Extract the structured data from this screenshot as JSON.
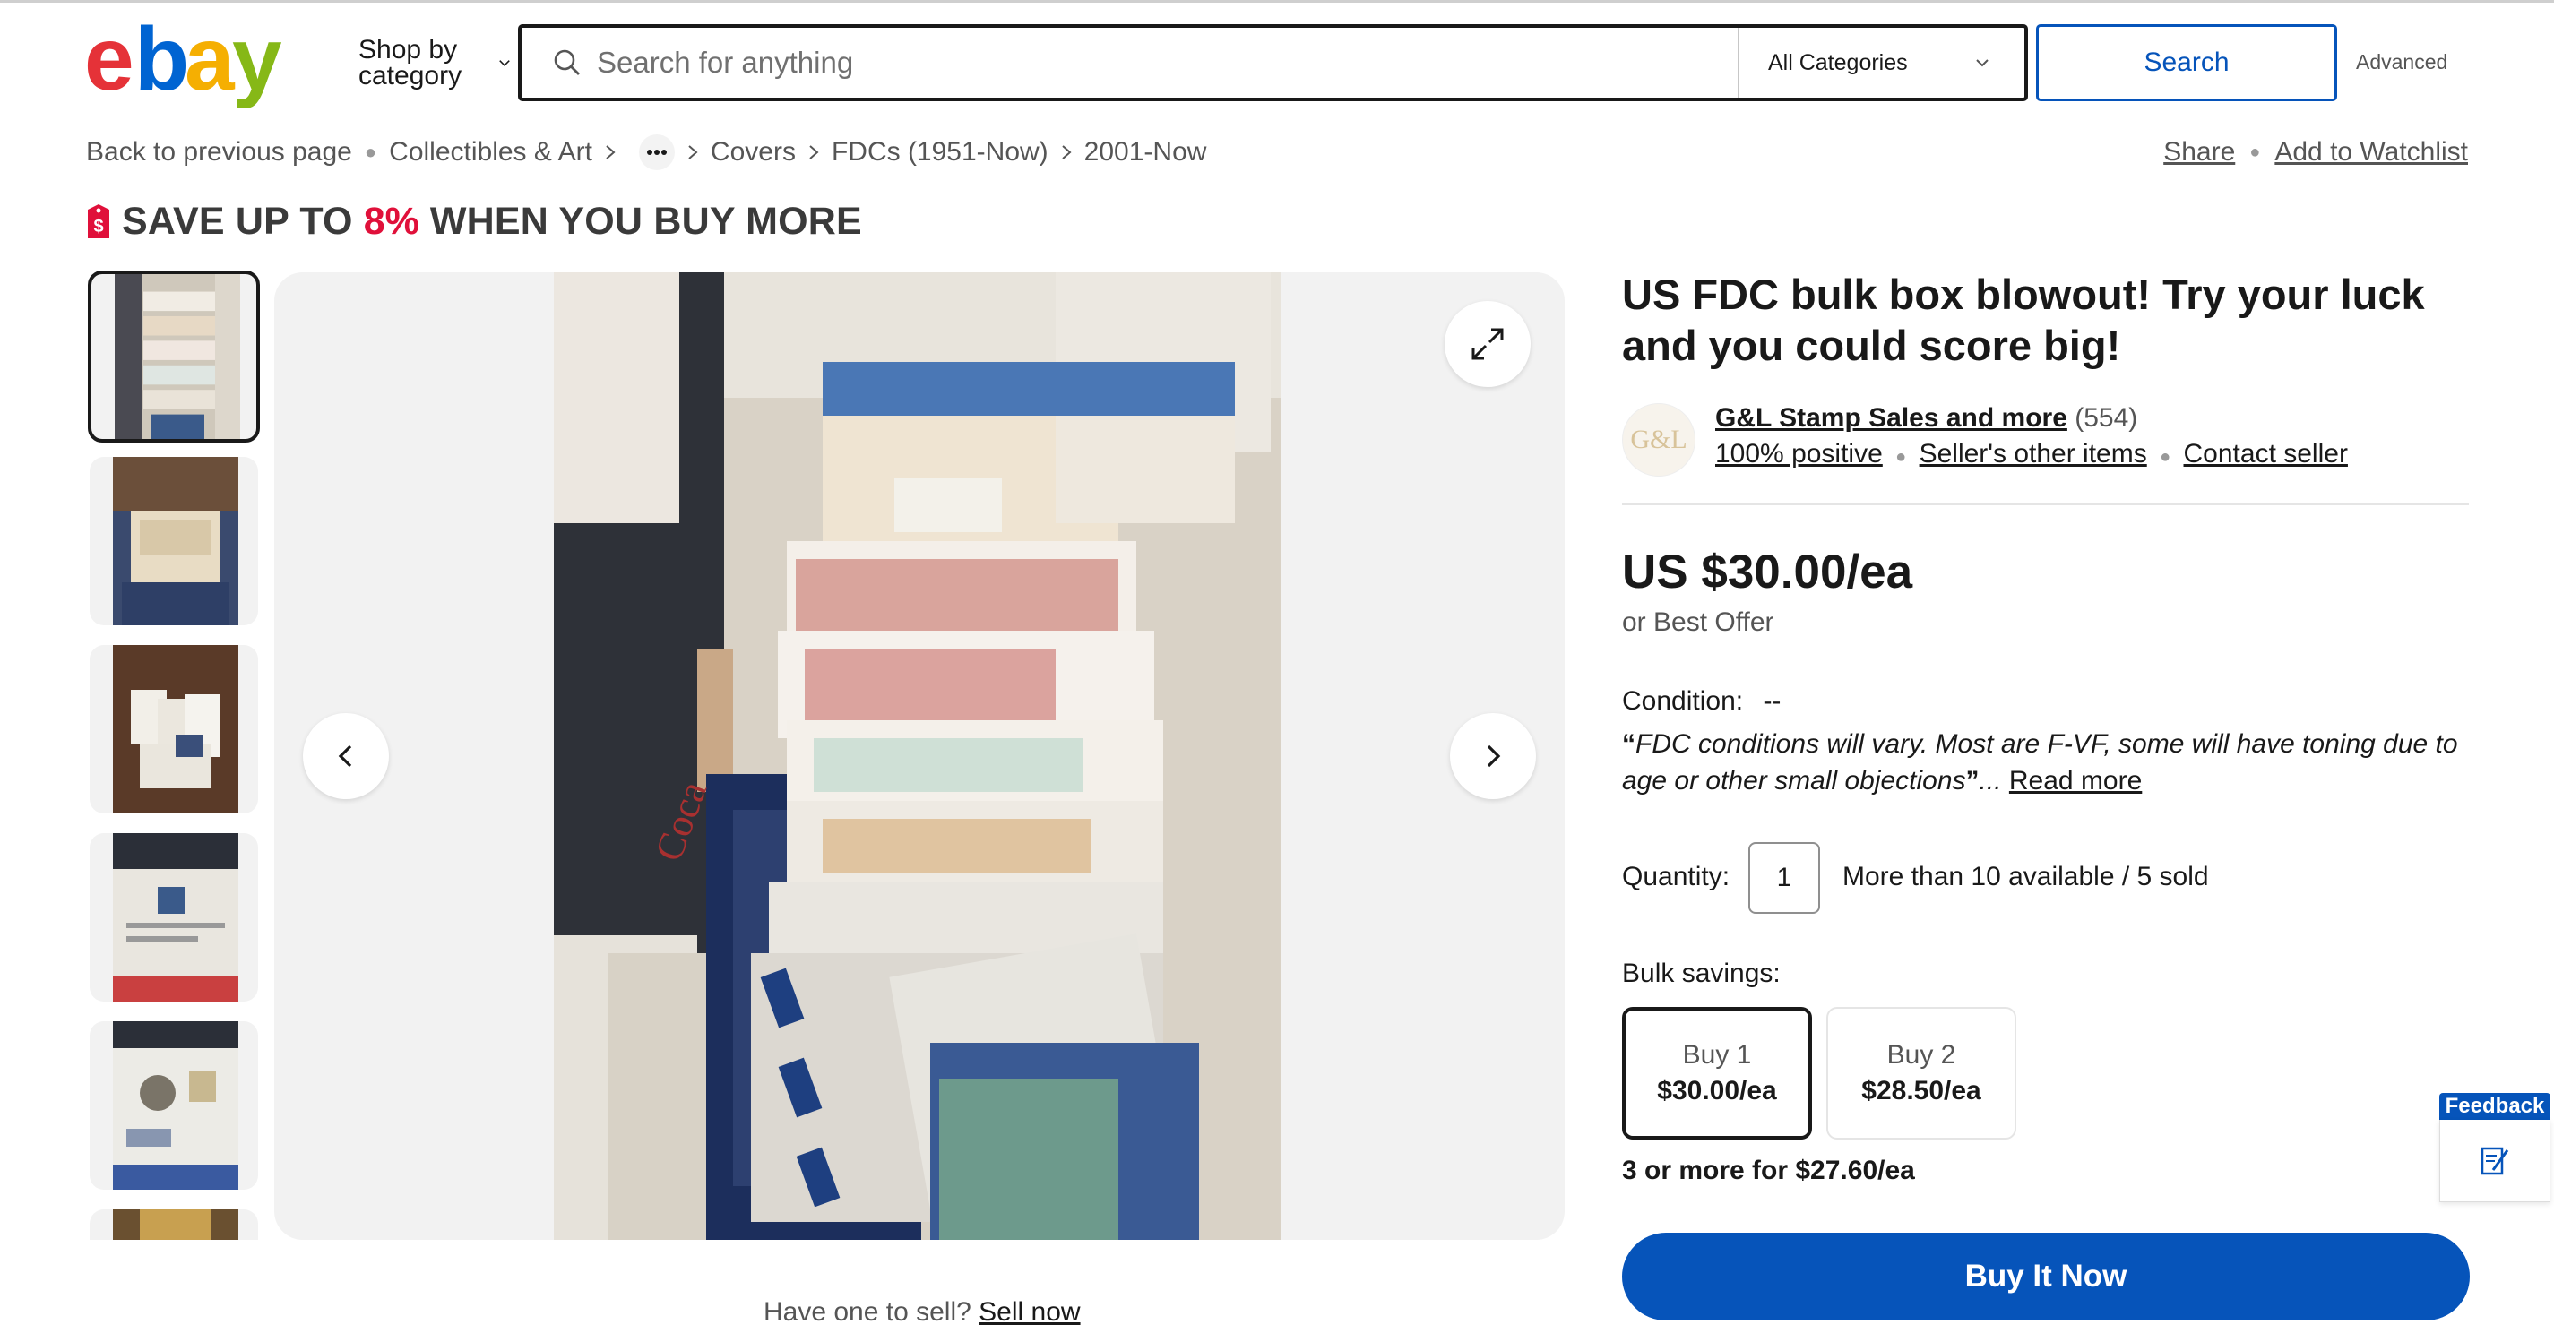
{
  "brand": {
    "logo_letters": [
      "e",
      "b",
      "a",
      "y"
    ],
    "logo_colors": [
      "#e53238",
      "#0064d2",
      "#f5af02",
      "#86b817"
    ]
  },
  "header": {
    "shop_by_category": "Shop by category",
    "search_placeholder": "Search for anything",
    "category_select": "All Categories",
    "search_button": "Search",
    "advanced": "Advanced"
  },
  "breadcrumb": {
    "back": "Back to previous page",
    "items": [
      "Collectibles & Art",
      "Covers",
      "FDCs (1951-Now)",
      "2001-Now"
    ],
    "more_icon": "ellipsis-icon"
  },
  "actions": {
    "share": "Share",
    "watchlist": "Add to Watchlist"
  },
  "promo": {
    "prefix": "SAVE UP TO",
    "percent": "8%",
    "suffix": "WHEN YOU BUY MORE",
    "accent": "#e0103a"
  },
  "gallery": {
    "thumbnail_count_visible": 6,
    "selected_index": 0
  },
  "sell": {
    "question": "Have one to sell?",
    "link": "Sell now"
  },
  "listing": {
    "title": "US FDC bulk box blowout! Try your luck and you could score big!",
    "seller": {
      "logo_text": "G&L",
      "name": "G&L Stamp Sales and more",
      "count": "(554)",
      "positive": "100% positive",
      "other_items": "Seller's other items",
      "contact": "Contact seller"
    },
    "price": "US $30.00/ea",
    "best_offer": "or Best Offer",
    "condition_label": "Condition:",
    "condition_value": "--",
    "condition_desc": "FDC conditions will vary. Most are F-VF, some will have toning due to age or other small objections",
    "read_more": "Read more",
    "quantity_label": "Quantity:",
    "quantity_value": "1",
    "availability": "More than 10 available / 5 sold",
    "bulk_label": "Bulk savings:",
    "bulk_options": [
      {
        "qty": "Buy 1",
        "price": "$30.00/ea"
      },
      {
        "qty": "Buy 2",
        "price": "$28.50/ea"
      }
    ],
    "bulk_more": "3 or more for $27.60/ea",
    "buy_now": "Buy It Now",
    "accent_blue": "#0654ba"
  },
  "feedback": {
    "label": "Feedback"
  }
}
